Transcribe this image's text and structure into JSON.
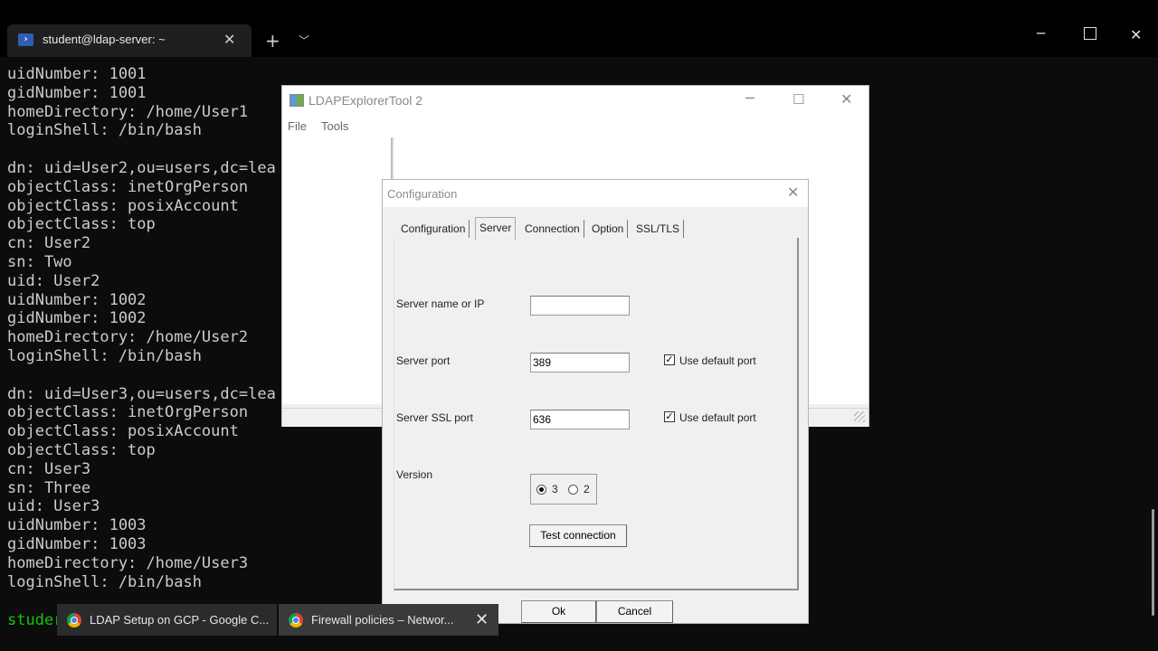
{
  "terminal": {
    "tab_title": "student@ldap-server: ~",
    "lines": [
      "uidNumber: 1001",
      "gidNumber: 1001",
      "homeDirectory: /home/User1",
      "loginShell: /bin/bash",
      "",
      "dn: uid=User2,ou=users,dc=lea",
      "objectClass: inetOrgPerson",
      "objectClass: posixAccount",
      "objectClass: top",
      "cn: User2",
      "sn: Two",
      "uid: User2",
      "uidNumber: 1002",
      "gidNumber: 1002",
      "homeDirectory: /home/User2",
      "loginShell: /bin/bash",
      "",
      "dn: uid=User3,ou=users,dc=lea",
      "objectClass: inetOrgPerson",
      "objectClass: posixAccount",
      "objectClass: top",
      "cn: User3",
      "sn: Three",
      "uid: User3",
      "uidNumber: 1003",
      "gidNumber: 1003",
      "homeDirectory: /home/User3",
      "loginShell: /bin/bash"
    ],
    "prompt": "studer",
    "prompt_color": "#16c60c"
  },
  "ldap_window": {
    "title": "LDAPExplorerTool 2",
    "menu": {
      "file": "File",
      "tools": "Tools"
    }
  },
  "config_dialog": {
    "title": "Configuration",
    "tabs": [
      "Configuration",
      "Server",
      "Connection",
      "Option",
      "SSL/TLS"
    ],
    "active_tab": "Server",
    "server_name_label": "Server name or IP",
    "server_name_value": "",
    "server_port_label": "Server port",
    "server_port_value": "389",
    "use_default_port_label": "Use default port",
    "use_default_port_checked": true,
    "server_ssl_port_label": "Server SSL port",
    "server_ssl_port_value": "636",
    "use_default_ssl_port_label": "Use default port",
    "use_default_ssl_port_checked": true,
    "version_label": "Version",
    "version_options": [
      "3",
      "2"
    ],
    "version_selected": "3",
    "test_connection_label": "Test connection",
    "ok_label": "Ok",
    "cancel_label": "Cancel"
  },
  "taskbar": {
    "items": [
      {
        "label": "LDAP Setup on GCP - Google C...",
        "icon": "chrome-icon"
      },
      {
        "label": "Firewall policies – Networ...",
        "icon": "chrome-icon"
      }
    ]
  }
}
